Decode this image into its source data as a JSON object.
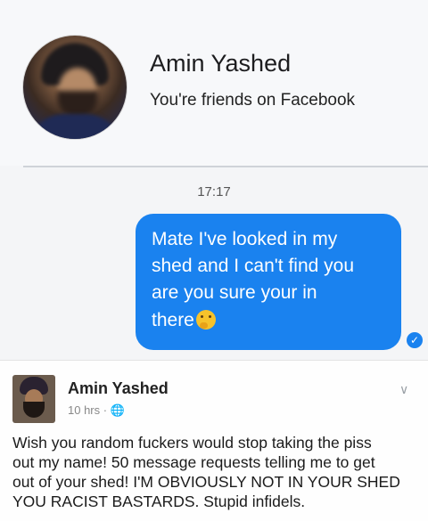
{
  "profile": {
    "name": "Amin Yashed",
    "subtitle": "You're friends on Facebook"
  },
  "chat": {
    "time": "17:17",
    "message_lines": [
      "Mate I've looked in my",
      "shed and I can't find you",
      "are you sure your in",
      "there"
    ],
    "emoji": "thinking-face-emoji",
    "read_icon": "check-icon"
  },
  "post": {
    "author": "Amin Yashed",
    "meta": "10 hrs · ",
    "globe_icon": "globe-icon",
    "menu_icon": "chevron-down-icon",
    "text_lines": [
      "Wish you random fuckers would stop taking the piss",
      "out my name! 50 message requests telling me to get",
      "out of your shed! I'M OBVIOUSLY NOT IN YOUR SHED",
      "YOU RACIST BASTARDS. Stupid infidels."
    ]
  },
  "colors": {
    "bubble": "#1a82ef",
    "background": "#f4f5f7"
  }
}
